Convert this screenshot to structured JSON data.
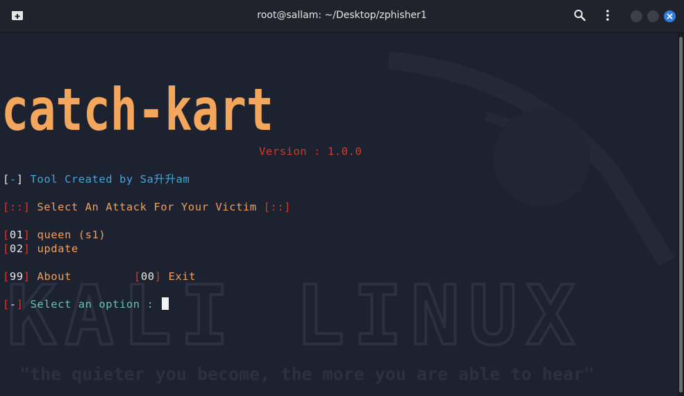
{
  "window": {
    "title": "root@sallam: ~/Desktop/zphisher1"
  },
  "icons": {
    "new_tab": "new-tab-icon",
    "search": "search-icon",
    "menu": "kebab-menu-icon",
    "minimize": "minimize-icon",
    "maximize": "maximize-icon",
    "close": "close-icon"
  },
  "terminal": {
    "banner_text": "catch-kart",
    "version": "Version : 1.0.0",
    "credit": {
      "bracket_open": "[",
      "mark": "-",
      "bracket_close": "]",
      "text": " Tool Created by Sa升升am"
    },
    "heading": {
      "left": "[::]",
      "text": " Select An Attack For Your Victim ",
      "right": "[::]"
    },
    "options": [
      {
        "num": "01",
        "label": "queen (s1)"
      },
      {
        "num": "02",
        "label": "update"
      }
    ],
    "extra_options": [
      {
        "num": "99",
        "label": "About"
      },
      {
        "num": "00",
        "label": "Exit"
      }
    ],
    "prompt": {
      "mark": "-",
      "text": " Select an option : "
    }
  },
  "background": {
    "wordmark": "KALI LINUX",
    "quote": "\"the quieter you become, the more you are able to hear\""
  },
  "colors": {
    "terminal_bg": "#1d2230",
    "banner": "#f4a65c",
    "red": "#d23b2c",
    "orange": "#f0a060",
    "blue": "#47a6d8",
    "teal": "#68c2b0",
    "close_button": "#2f7ee0"
  }
}
